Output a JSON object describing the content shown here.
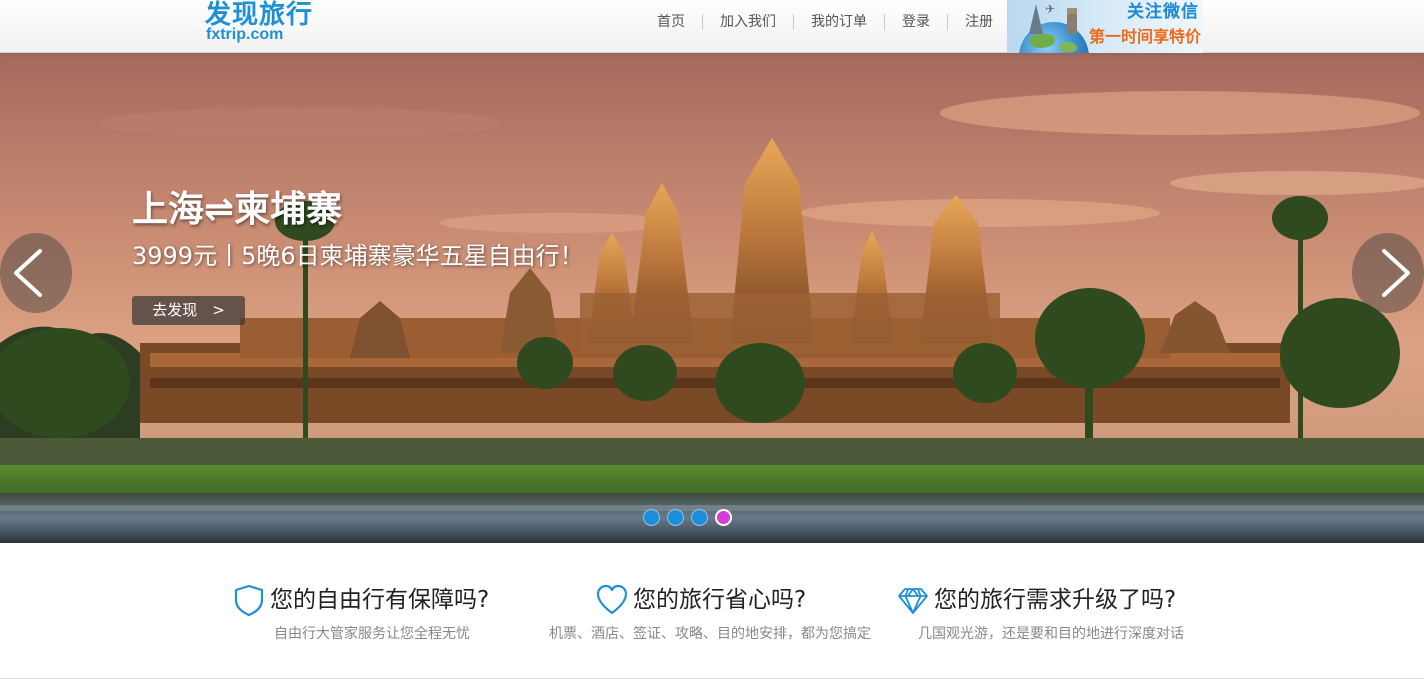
{
  "header": {
    "logo_cn": "发现旅行",
    "logo_en": "fxtrip.com",
    "nav": [
      {
        "label": "首页"
      },
      {
        "label": "加入我们"
      },
      {
        "label": "我的订单"
      },
      {
        "label": "登录"
      },
      {
        "label": "注册"
      }
    ],
    "wechat_banner": {
      "title": "关注微信",
      "subtitle": "第一时间享特价"
    }
  },
  "hero": {
    "title": "上海⇌柬埔寨",
    "subtitle": "3999元丨5晚6日柬埔寨豪华五星自由行！",
    "cta_label": "去发现　>",
    "slide_count": 4,
    "active_slide": 4,
    "colors": {
      "dot": "#1d8ed8",
      "dot_active": "#d63ad8"
    }
  },
  "features": [
    {
      "icon": "shield-icon",
      "title": "您的自由行有保障吗?",
      "desc": "自由行大管家服务让您全程无忧"
    },
    {
      "icon": "heart-icon",
      "title": "您的旅行省心吗?",
      "desc": "机票、酒店、签证、攻略、目的地安排，都为您搞定"
    },
    {
      "icon": "diamond-icon",
      "title": "您的旅行需求升级了吗?",
      "desc": "几国观光游，还是要和目的地进行深度对话"
    }
  ],
  "colors": {
    "accent": "#1e90d8",
    "orange": "#f06a1c"
  }
}
